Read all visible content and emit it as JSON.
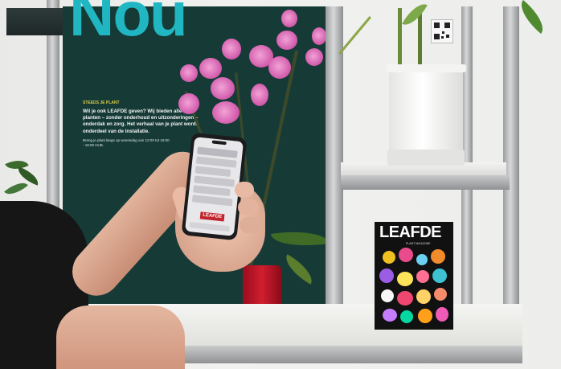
{
  "poster": {
    "headline_fragment": "Nou",
    "kicker": "STEEDS JE PLANT",
    "body": "Wil je ook LEAFDE geven? Wij bieden alle planten – zonder onderhoud en uitzonderingen – onderdak en zorg. Het verhaal van je plant wordt onderdeel van de installatie.",
    "small_print": "Breng je plant langs op woensdag van 12:00 tot 16:00 - 18:00 HUB.",
    "colors": {
      "background": "#163b37",
      "headline": "#20b7c2",
      "kicker": "#d8c84a"
    }
  },
  "phone": {
    "app_logo_text": "LEAFDE",
    "screen_color": "#e8e8ea",
    "logo_color": "#c0232c"
  },
  "magazine": {
    "title": "LEAFDE",
    "subtitle": "PLANT MAGAZINE"
  },
  "scene": {
    "description_icons": [
      "orchid-plant",
      "potted-plant",
      "qr-code",
      "shelving-unit",
      "smartphone",
      "hand"
    ]
  }
}
